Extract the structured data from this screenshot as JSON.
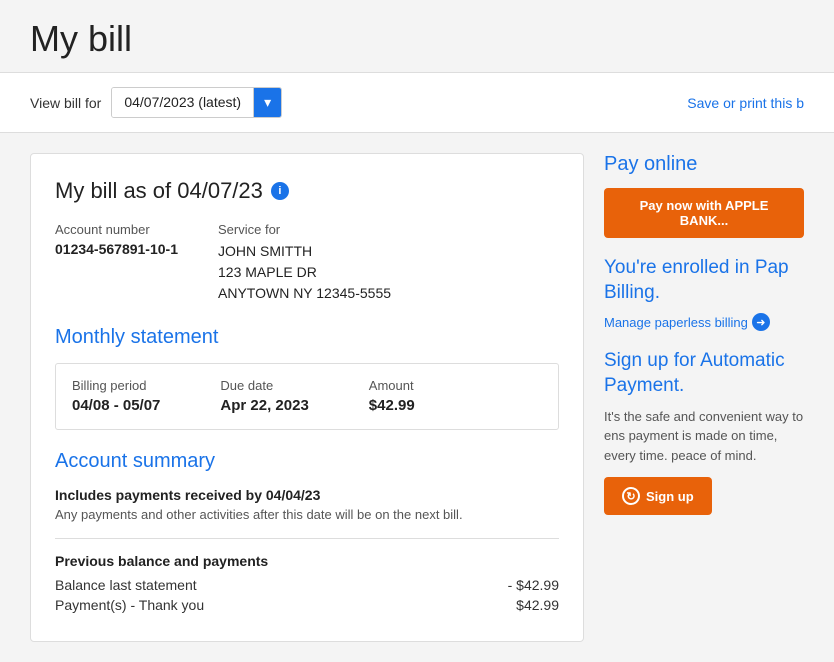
{
  "page": {
    "title": "My bill"
  },
  "view_bill_bar": {
    "label": "View bill for",
    "date_value": "04/07/2023 (latest)",
    "save_print_link": "Save or print this b"
  },
  "bill_card": {
    "bill_as_of": "My bill as of 04/07/23",
    "info_icon": "i",
    "account_number_label": "Account number",
    "account_number_value": "01234-567891-10-1",
    "service_for_label": "Service for",
    "service_name": "JOHN SMITTH",
    "service_address1": "123 MAPLE DR",
    "service_address2": "ANYTOWN NY 12345-5555"
  },
  "monthly_statement": {
    "title": "Monthly statement",
    "billing_period_label": "Billing period",
    "billing_period_value": "04/08 - 05/07",
    "due_date_label": "Due date",
    "due_date_value": "Apr 22, 2023",
    "amount_label": "Amount",
    "amount_value": "$42.99"
  },
  "account_summary": {
    "title": "Account summary",
    "includes_text": "Includes payments received by 04/04/23",
    "note_text": "Any payments and other activities after this date will be on the next bill.",
    "prev_balance_title": "Previous balance and payments",
    "balance_last_label": "Balance last statement",
    "balance_last_value": "- $42.99",
    "payment_label": "Payment(s) - Thank you",
    "payment_value": "$42.99"
  },
  "sidebar": {
    "pay_online_title": "Pay online",
    "pay_now_btn": "Pay now with APPLE BANK...",
    "enrolled_title": "You're enrolled in Pap Billing.",
    "manage_paperless_link": "Manage paperless billing",
    "signup_title": "Sign up for Automatic Payment.",
    "signup_desc": "It's the safe and convenient way to ens payment is made on time, every time. peace of mind.",
    "signup_btn": "Sign up"
  }
}
